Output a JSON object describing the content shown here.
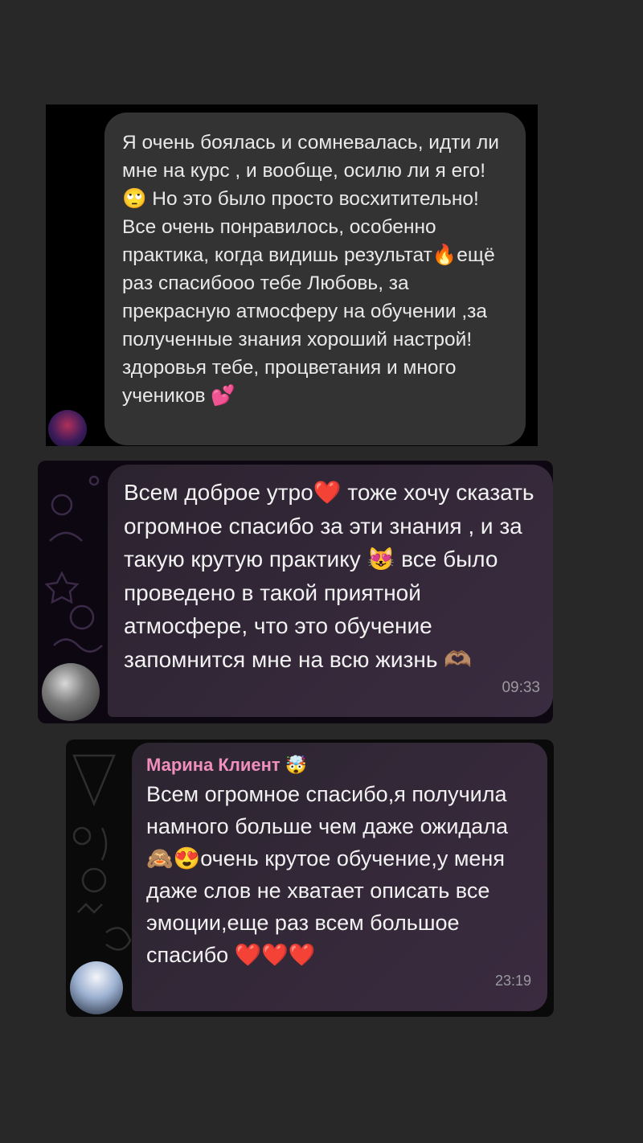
{
  "messages": [
    {
      "text": "Я очень боялась и сомневалась, идти ли мне на курс , и вообще, осилю ли я его!🙄 Но это было просто восхитительно! Все очень понравилось, особенно практика, когда видишь результат🔥ещё раз спасибооо тебе Любовь, за прекрасную атмосферу на обучении ,за полученные знания хороший настрой! здоровья тебе, процветания и много учеников 💕"
    },
    {
      "text": "Всем доброе утро❤️ тоже хочу сказать огромное спасибо за эти знания , и за такую крутую практику 😻 все было проведено в такой приятной атмосфере, что это обучение запомнится мне на всю жизнь 🫶🏽",
      "time": "09:33"
    },
    {
      "sender": "Марина Клиент 🤯",
      "text": "Всем огромное спасибо,я получила намного больше чем даже ожидала 🙈😍очень крутое обучение,у меня даже слов не хватает описать все эмоции,еще раз всем большое спасибо ❤️❤️❤️",
      "time": "23:19"
    }
  ],
  "colors": {
    "page_background": "#282828",
    "bubble_dark": "#333334",
    "bubble_purple": "#34283a",
    "sender_name": "#f08fbd",
    "time_text": "#9a9a9f"
  }
}
